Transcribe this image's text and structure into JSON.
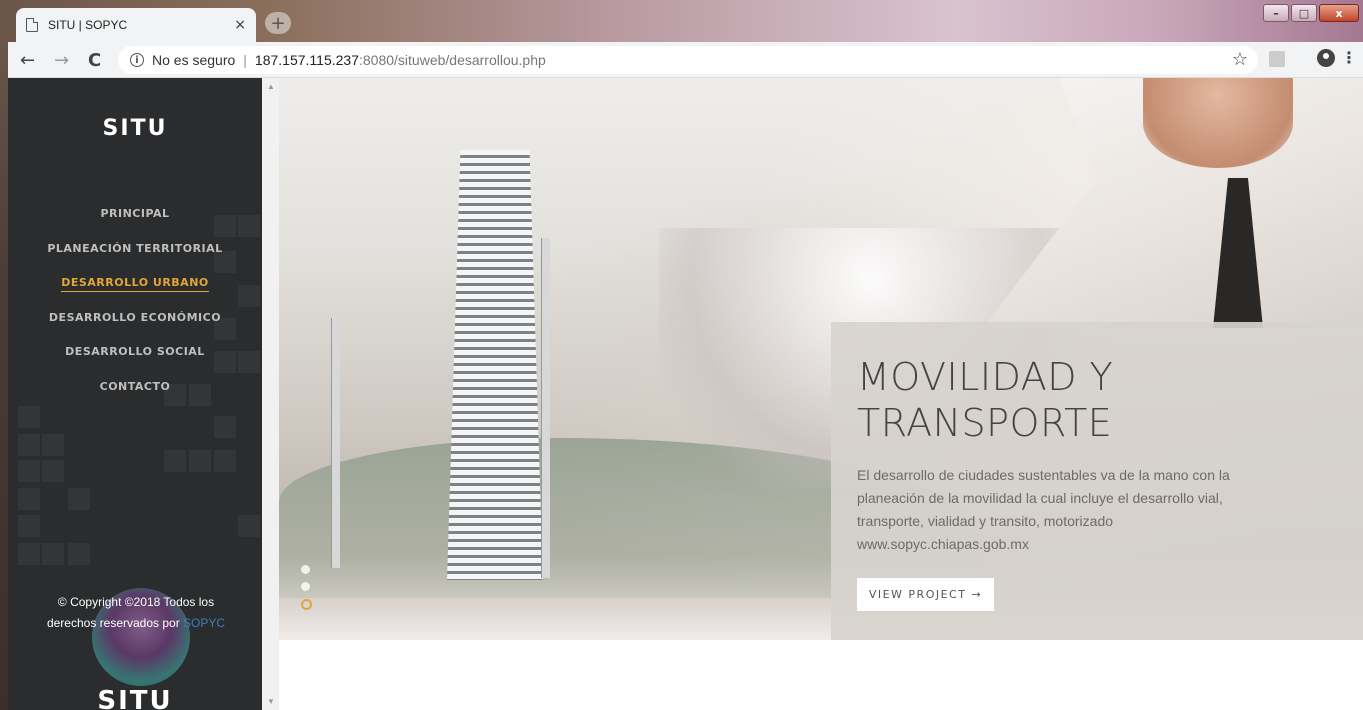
{
  "browser": {
    "tab_title": "SITU | SOPYC",
    "tab_close": "×",
    "new_tab": "+",
    "back": "←",
    "forward": "→",
    "reload": "C",
    "security_label": "No es seguro",
    "url_host": "187.157.115.237",
    "url_path": ":8080/situweb/desarrollou.php",
    "bookmark_icon": "☆",
    "menu_icon": "⋮"
  },
  "window_controls": {
    "minimize": "–",
    "maximize": "□",
    "close": "x"
  },
  "sidebar": {
    "logo": "SITU",
    "nav": [
      {
        "label": "PRINCIPAL"
      },
      {
        "label": "PLANEACIÓN TERRITORIAL"
      },
      {
        "label": "DESARROLLO URBANO",
        "active": true
      },
      {
        "label": "DESARROLLO ECONÓMICO"
      },
      {
        "label": "DESARROLLO SOCIAL"
      },
      {
        "label": "CONTACTO"
      }
    ],
    "copyright_prefix": "© Copyright ©2018 Todos los derechos reservados por ",
    "copyright_brand": "SOPYC",
    "footer_logo": "SITU"
  },
  "hero": {
    "title_line1": "MOVILIDAD Y",
    "title_line2": "TRANSPORTE",
    "body_line1": "El desarrollo de ciudades sustentables va de la mano con la",
    "body_line2": "planeación de la movilidad la cual incluye el desarrollo vial,",
    "body_line3": "transporte, vialidad y transito, motorizado",
    "body_line4": "www.sopyc.chiapas.gob.mx",
    "button_label": "VIEW PROJECT →",
    "slides": 3,
    "active_slide": 3
  },
  "colors": {
    "sidebar_bg": "#2b2c2d",
    "accent": "#e0a63a",
    "brand_link": "#3d7fb8"
  }
}
